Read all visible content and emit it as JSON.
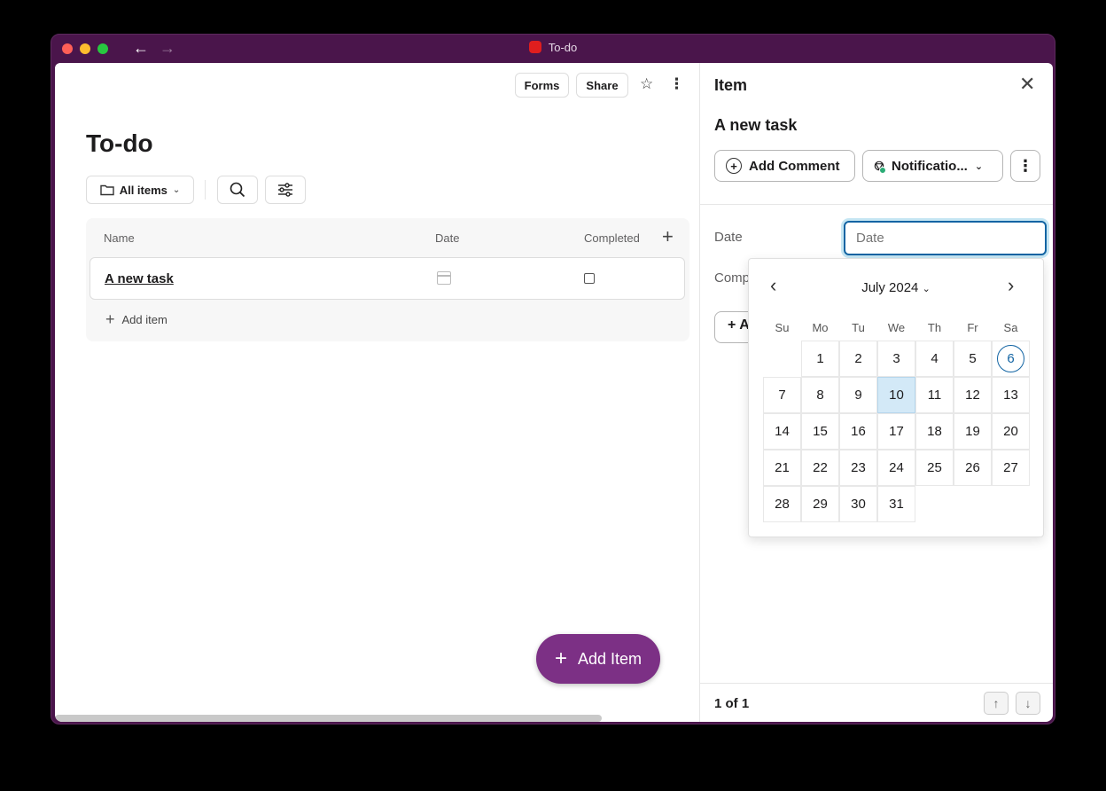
{
  "window": {
    "title": "To-do"
  },
  "toolbar": {
    "forms": "Forms",
    "share": "Share"
  },
  "list": {
    "title": "To-do",
    "filter_label": "All items",
    "columns": [
      "Name",
      "Date",
      "Completed"
    ],
    "rows": [
      {
        "name": "A new task",
        "completed": false
      }
    ],
    "add_item": "Add item"
  },
  "fab": {
    "label": "Add Item"
  },
  "panel": {
    "header": "Item",
    "item_title": "A new task",
    "add_comment": "Add Comment",
    "notifications": "Notificatio...",
    "date_label": "Date",
    "date_placeholder": "Date",
    "completed_label": "Comp",
    "hidden_button": "+ A",
    "pager": "1 of 1"
  },
  "datepicker": {
    "month_label": "July 2024",
    "weekdays": [
      "Su",
      "Mo",
      "Tu",
      "We",
      "Th",
      "Fr",
      "Sa"
    ],
    "first_weekday_index": 1,
    "days_in_month": 31,
    "today": 6,
    "selected": 10
  },
  "icons": {
    "back": "arrow-left-icon",
    "forward": "arrow-right-icon",
    "star": "star-icon",
    "more": "kebab-icon",
    "folder": "folder-icon",
    "search": "search-icon",
    "settings": "sliders-icon",
    "calendar": "calendar-icon",
    "close": "close-icon"
  },
  "colors": {
    "window_chrome": "#4a154b",
    "accent": "#7c3085",
    "focus": "#1264a3",
    "selected_day": "#d3e9f7",
    "bell_status": "#2bac76"
  }
}
